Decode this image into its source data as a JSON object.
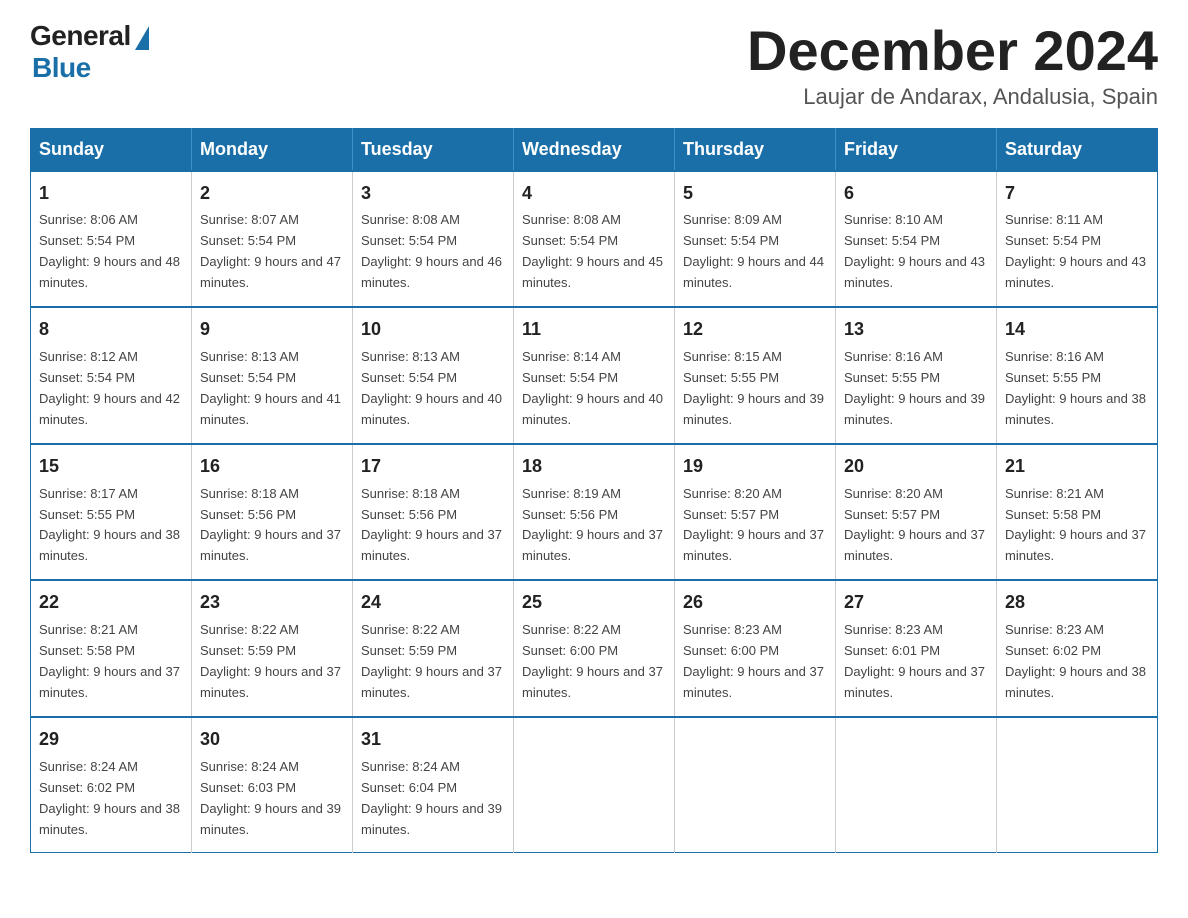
{
  "header": {
    "logo": {
      "general": "General",
      "blue": "Blue"
    },
    "title": "December 2024",
    "location": "Laujar de Andarax, Andalusia, Spain"
  },
  "calendar": {
    "days_of_week": [
      "Sunday",
      "Monday",
      "Tuesday",
      "Wednesday",
      "Thursday",
      "Friday",
      "Saturday"
    ],
    "weeks": [
      [
        {
          "day": "1",
          "sunrise": "8:06 AM",
          "sunset": "5:54 PM",
          "daylight": "9 hours and 48 minutes."
        },
        {
          "day": "2",
          "sunrise": "8:07 AM",
          "sunset": "5:54 PM",
          "daylight": "9 hours and 47 minutes."
        },
        {
          "day": "3",
          "sunrise": "8:08 AM",
          "sunset": "5:54 PM",
          "daylight": "9 hours and 46 minutes."
        },
        {
          "day": "4",
          "sunrise": "8:08 AM",
          "sunset": "5:54 PM",
          "daylight": "9 hours and 45 minutes."
        },
        {
          "day": "5",
          "sunrise": "8:09 AM",
          "sunset": "5:54 PM",
          "daylight": "9 hours and 44 minutes."
        },
        {
          "day": "6",
          "sunrise": "8:10 AM",
          "sunset": "5:54 PM",
          "daylight": "9 hours and 43 minutes."
        },
        {
          "day": "7",
          "sunrise": "8:11 AM",
          "sunset": "5:54 PM",
          "daylight": "9 hours and 43 minutes."
        }
      ],
      [
        {
          "day": "8",
          "sunrise": "8:12 AM",
          "sunset": "5:54 PM",
          "daylight": "9 hours and 42 minutes."
        },
        {
          "day": "9",
          "sunrise": "8:13 AM",
          "sunset": "5:54 PM",
          "daylight": "9 hours and 41 minutes."
        },
        {
          "day": "10",
          "sunrise": "8:13 AM",
          "sunset": "5:54 PM",
          "daylight": "9 hours and 40 minutes."
        },
        {
          "day": "11",
          "sunrise": "8:14 AM",
          "sunset": "5:54 PM",
          "daylight": "9 hours and 40 minutes."
        },
        {
          "day": "12",
          "sunrise": "8:15 AM",
          "sunset": "5:55 PM",
          "daylight": "9 hours and 39 minutes."
        },
        {
          "day": "13",
          "sunrise": "8:16 AM",
          "sunset": "5:55 PM",
          "daylight": "9 hours and 39 minutes."
        },
        {
          "day": "14",
          "sunrise": "8:16 AM",
          "sunset": "5:55 PM",
          "daylight": "9 hours and 38 minutes."
        }
      ],
      [
        {
          "day": "15",
          "sunrise": "8:17 AM",
          "sunset": "5:55 PM",
          "daylight": "9 hours and 38 minutes."
        },
        {
          "day": "16",
          "sunrise": "8:18 AM",
          "sunset": "5:56 PM",
          "daylight": "9 hours and 37 minutes."
        },
        {
          "day": "17",
          "sunrise": "8:18 AM",
          "sunset": "5:56 PM",
          "daylight": "9 hours and 37 minutes."
        },
        {
          "day": "18",
          "sunrise": "8:19 AM",
          "sunset": "5:56 PM",
          "daylight": "9 hours and 37 minutes."
        },
        {
          "day": "19",
          "sunrise": "8:20 AM",
          "sunset": "5:57 PM",
          "daylight": "9 hours and 37 minutes."
        },
        {
          "day": "20",
          "sunrise": "8:20 AM",
          "sunset": "5:57 PM",
          "daylight": "9 hours and 37 minutes."
        },
        {
          "day": "21",
          "sunrise": "8:21 AM",
          "sunset": "5:58 PM",
          "daylight": "9 hours and 37 minutes."
        }
      ],
      [
        {
          "day": "22",
          "sunrise": "8:21 AM",
          "sunset": "5:58 PM",
          "daylight": "9 hours and 37 minutes."
        },
        {
          "day": "23",
          "sunrise": "8:22 AM",
          "sunset": "5:59 PM",
          "daylight": "9 hours and 37 minutes."
        },
        {
          "day": "24",
          "sunrise": "8:22 AM",
          "sunset": "5:59 PM",
          "daylight": "9 hours and 37 minutes."
        },
        {
          "day": "25",
          "sunrise": "8:22 AM",
          "sunset": "6:00 PM",
          "daylight": "9 hours and 37 minutes."
        },
        {
          "day": "26",
          "sunrise": "8:23 AM",
          "sunset": "6:00 PM",
          "daylight": "9 hours and 37 minutes."
        },
        {
          "day": "27",
          "sunrise": "8:23 AM",
          "sunset": "6:01 PM",
          "daylight": "9 hours and 37 minutes."
        },
        {
          "day": "28",
          "sunrise": "8:23 AM",
          "sunset": "6:02 PM",
          "daylight": "9 hours and 38 minutes."
        }
      ],
      [
        {
          "day": "29",
          "sunrise": "8:24 AM",
          "sunset": "6:02 PM",
          "daylight": "9 hours and 38 minutes."
        },
        {
          "day": "30",
          "sunrise": "8:24 AM",
          "sunset": "6:03 PM",
          "daylight": "9 hours and 39 minutes."
        },
        {
          "day": "31",
          "sunrise": "8:24 AM",
          "sunset": "6:04 PM",
          "daylight": "9 hours and 39 minutes."
        },
        null,
        null,
        null,
        null
      ]
    ]
  }
}
